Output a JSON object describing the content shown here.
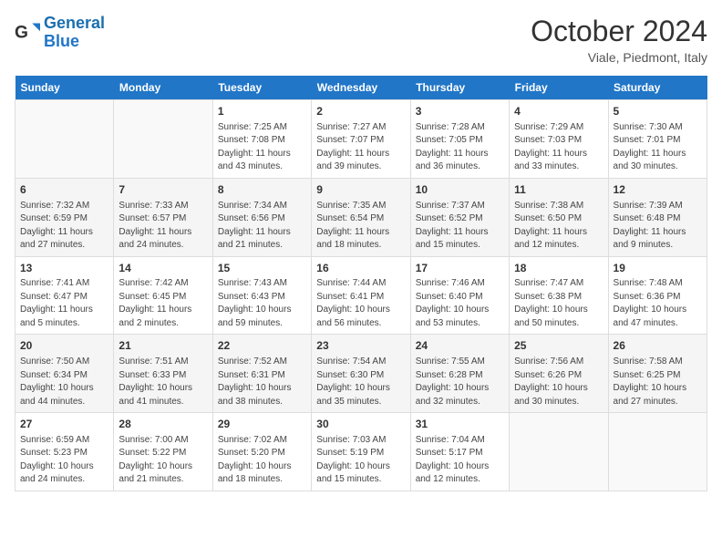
{
  "header": {
    "logo_line1": "General",
    "logo_line2": "Blue",
    "month": "October 2024",
    "location": "Viale, Piedmont, Italy"
  },
  "days_of_week": [
    "Sunday",
    "Monday",
    "Tuesday",
    "Wednesday",
    "Thursday",
    "Friday",
    "Saturday"
  ],
  "weeks": [
    {
      "alt": false,
      "days": [
        {
          "num": "",
          "sunrise": "",
          "sunset": "",
          "daylight": "",
          "empty": true
        },
        {
          "num": "",
          "sunrise": "",
          "sunset": "",
          "daylight": "",
          "empty": true
        },
        {
          "num": "1",
          "sunrise": "Sunrise: 7:25 AM",
          "sunset": "Sunset: 7:08 PM",
          "daylight": "Daylight: 11 hours and 43 minutes.",
          "empty": false
        },
        {
          "num": "2",
          "sunrise": "Sunrise: 7:27 AM",
          "sunset": "Sunset: 7:07 PM",
          "daylight": "Daylight: 11 hours and 39 minutes.",
          "empty": false
        },
        {
          "num": "3",
          "sunrise": "Sunrise: 7:28 AM",
          "sunset": "Sunset: 7:05 PM",
          "daylight": "Daylight: 11 hours and 36 minutes.",
          "empty": false
        },
        {
          "num": "4",
          "sunrise": "Sunrise: 7:29 AM",
          "sunset": "Sunset: 7:03 PM",
          "daylight": "Daylight: 11 hours and 33 minutes.",
          "empty": false
        },
        {
          "num": "5",
          "sunrise": "Sunrise: 7:30 AM",
          "sunset": "Sunset: 7:01 PM",
          "daylight": "Daylight: 11 hours and 30 minutes.",
          "empty": false
        }
      ]
    },
    {
      "alt": true,
      "days": [
        {
          "num": "6",
          "sunrise": "Sunrise: 7:32 AM",
          "sunset": "Sunset: 6:59 PM",
          "daylight": "Daylight: 11 hours and 27 minutes.",
          "empty": false
        },
        {
          "num": "7",
          "sunrise": "Sunrise: 7:33 AM",
          "sunset": "Sunset: 6:57 PM",
          "daylight": "Daylight: 11 hours and 24 minutes.",
          "empty": false
        },
        {
          "num": "8",
          "sunrise": "Sunrise: 7:34 AM",
          "sunset": "Sunset: 6:56 PM",
          "daylight": "Daylight: 11 hours and 21 minutes.",
          "empty": false
        },
        {
          "num": "9",
          "sunrise": "Sunrise: 7:35 AM",
          "sunset": "Sunset: 6:54 PM",
          "daylight": "Daylight: 11 hours and 18 minutes.",
          "empty": false
        },
        {
          "num": "10",
          "sunrise": "Sunrise: 7:37 AM",
          "sunset": "Sunset: 6:52 PM",
          "daylight": "Daylight: 11 hours and 15 minutes.",
          "empty": false
        },
        {
          "num": "11",
          "sunrise": "Sunrise: 7:38 AM",
          "sunset": "Sunset: 6:50 PM",
          "daylight": "Daylight: 11 hours and 12 minutes.",
          "empty": false
        },
        {
          "num": "12",
          "sunrise": "Sunrise: 7:39 AM",
          "sunset": "Sunset: 6:48 PM",
          "daylight": "Daylight: 11 hours and 9 minutes.",
          "empty": false
        }
      ]
    },
    {
      "alt": false,
      "days": [
        {
          "num": "13",
          "sunrise": "Sunrise: 7:41 AM",
          "sunset": "Sunset: 6:47 PM",
          "daylight": "Daylight: 11 hours and 5 minutes.",
          "empty": false
        },
        {
          "num": "14",
          "sunrise": "Sunrise: 7:42 AM",
          "sunset": "Sunset: 6:45 PM",
          "daylight": "Daylight: 11 hours and 2 minutes.",
          "empty": false
        },
        {
          "num": "15",
          "sunrise": "Sunrise: 7:43 AM",
          "sunset": "Sunset: 6:43 PM",
          "daylight": "Daylight: 10 hours and 59 minutes.",
          "empty": false
        },
        {
          "num": "16",
          "sunrise": "Sunrise: 7:44 AM",
          "sunset": "Sunset: 6:41 PM",
          "daylight": "Daylight: 10 hours and 56 minutes.",
          "empty": false
        },
        {
          "num": "17",
          "sunrise": "Sunrise: 7:46 AM",
          "sunset": "Sunset: 6:40 PM",
          "daylight": "Daylight: 10 hours and 53 minutes.",
          "empty": false
        },
        {
          "num": "18",
          "sunrise": "Sunrise: 7:47 AM",
          "sunset": "Sunset: 6:38 PM",
          "daylight": "Daylight: 10 hours and 50 minutes.",
          "empty": false
        },
        {
          "num": "19",
          "sunrise": "Sunrise: 7:48 AM",
          "sunset": "Sunset: 6:36 PM",
          "daylight": "Daylight: 10 hours and 47 minutes.",
          "empty": false
        }
      ]
    },
    {
      "alt": true,
      "days": [
        {
          "num": "20",
          "sunrise": "Sunrise: 7:50 AM",
          "sunset": "Sunset: 6:34 PM",
          "daylight": "Daylight: 10 hours and 44 minutes.",
          "empty": false
        },
        {
          "num": "21",
          "sunrise": "Sunrise: 7:51 AM",
          "sunset": "Sunset: 6:33 PM",
          "daylight": "Daylight: 10 hours and 41 minutes.",
          "empty": false
        },
        {
          "num": "22",
          "sunrise": "Sunrise: 7:52 AM",
          "sunset": "Sunset: 6:31 PM",
          "daylight": "Daylight: 10 hours and 38 minutes.",
          "empty": false
        },
        {
          "num": "23",
          "sunrise": "Sunrise: 7:54 AM",
          "sunset": "Sunset: 6:30 PM",
          "daylight": "Daylight: 10 hours and 35 minutes.",
          "empty": false
        },
        {
          "num": "24",
          "sunrise": "Sunrise: 7:55 AM",
          "sunset": "Sunset: 6:28 PM",
          "daylight": "Daylight: 10 hours and 32 minutes.",
          "empty": false
        },
        {
          "num": "25",
          "sunrise": "Sunrise: 7:56 AM",
          "sunset": "Sunset: 6:26 PM",
          "daylight": "Daylight: 10 hours and 30 minutes.",
          "empty": false
        },
        {
          "num": "26",
          "sunrise": "Sunrise: 7:58 AM",
          "sunset": "Sunset: 6:25 PM",
          "daylight": "Daylight: 10 hours and 27 minutes.",
          "empty": false
        }
      ]
    },
    {
      "alt": false,
      "days": [
        {
          "num": "27",
          "sunrise": "Sunrise: 6:59 AM",
          "sunset": "Sunset: 5:23 PM",
          "daylight": "Daylight: 10 hours and 24 minutes.",
          "empty": false
        },
        {
          "num": "28",
          "sunrise": "Sunrise: 7:00 AM",
          "sunset": "Sunset: 5:22 PM",
          "daylight": "Daylight: 10 hours and 21 minutes.",
          "empty": false
        },
        {
          "num": "29",
          "sunrise": "Sunrise: 7:02 AM",
          "sunset": "Sunset: 5:20 PM",
          "daylight": "Daylight: 10 hours and 18 minutes.",
          "empty": false
        },
        {
          "num": "30",
          "sunrise": "Sunrise: 7:03 AM",
          "sunset": "Sunset: 5:19 PM",
          "daylight": "Daylight: 10 hours and 15 minutes.",
          "empty": false
        },
        {
          "num": "31",
          "sunrise": "Sunrise: 7:04 AM",
          "sunset": "Sunset: 5:17 PM",
          "daylight": "Daylight: 10 hours and 12 minutes.",
          "empty": false
        },
        {
          "num": "",
          "sunrise": "",
          "sunset": "",
          "daylight": "",
          "empty": true
        },
        {
          "num": "",
          "sunrise": "",
          "sunset": "",
          "daylight": "",
          "empty": true
        }
      ]
    }
  ]
}
